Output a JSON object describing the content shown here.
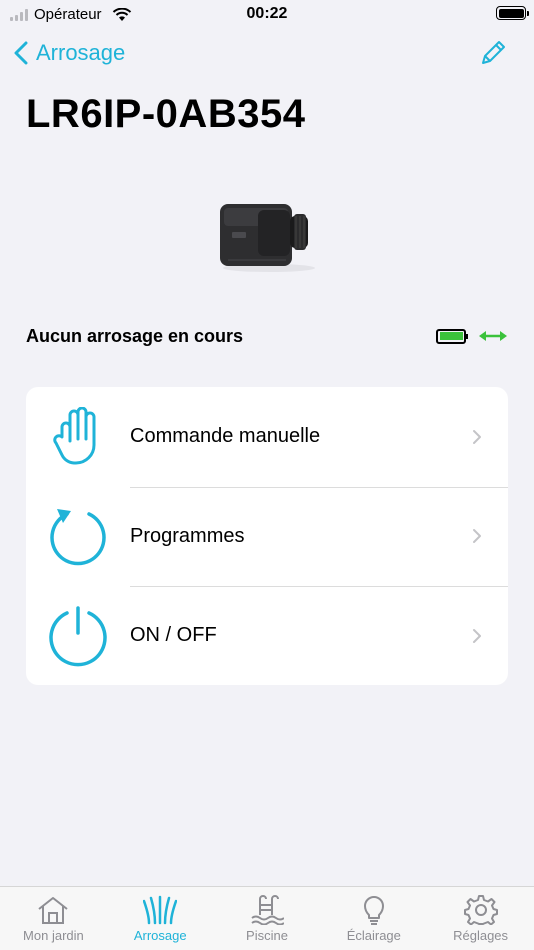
{
  "status_bar": {
    "carrier": "Opérateur",
    "time": "00:22"
  },
  "nav": {
    "back_label": "Arrosage",
    "edit_icon": "pencil-icon"
  },
  "device": {
    "name": "LR6IP-0AB354",
    "status": "Aucun arrosage en cours",
    "battery_color": "#3bc23b",
    "connection_color": "#3bc23b"
  },
  "menu": [
    {
      "label": "Commande manuelle",
      "icon": "hand-icon"
    },
    {
      "label": "Programmes",
      "icon": "refresh-icon"
    },
    {
      "label": "ON / OFF",
      "icon": "power-icon"
    }
  ],
  "tabs": [
    {
      "label": "Mon jardin",
      "icon": "home-icon",
      "active": false
    },
    {
      "label": "Arrosage",
      "icon": "grass-icon",
      "active": true
    },
    {
      "label": "Piscine",
      "icon": "pool-icon",
      "active": false
    },
    {
      "label": "Éclairage",
      "icon": "bulb-icon",
      "active": false
    },
    {
      "label": "Réglages",
      "icon": "gear-icon",
      "active": false
    }
  ],
  "colors": {
    "accent": "#1fb3d8",
    "inactive": "#8e8e93",
    "background": "#f2f2f7"
  }
}
